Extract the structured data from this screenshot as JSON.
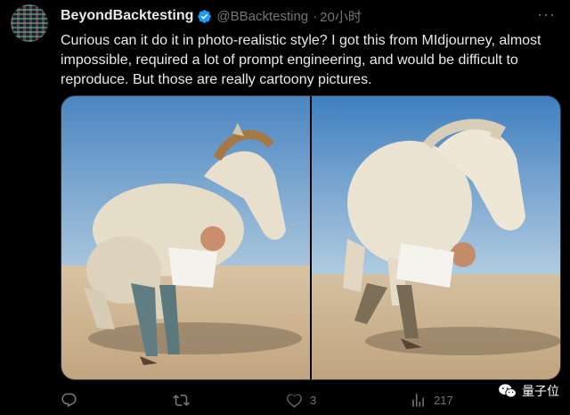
{
  "author": {
    "display_name": "BeyondBacktesting",
    "handle": "@BBacktesting",
    "separator": "·",
    "time": "20小时"
  },
  "tweet_text": "Curious can it do it in photo-realistic style? I got this from MIdjourney, almost impossible, required a lot of prompt engineering, and would be difficult to reproduce. But those are really cartoony pictures.",
  "icons": {
    "verified": "verified-badge-icon",
    "more": "more-icon",
    "reply": "reply-icon",
    "retweet": "retweet-icon",
    "like": "like-icon",
    "views": "views-icon"
  },
  "actions": {
    "reply_count": "",
    "retweet_count": "",
    "like_count": "3",
    "view_count": "217"
  },
  "watermark": {
    "text": "量子位"
  },
  "colors": {
    "background": "#000000",
    "text": "#e7e9ea",
    "secondary": "#71767b",
    "verified": "#1d9bf0"
  }
}
